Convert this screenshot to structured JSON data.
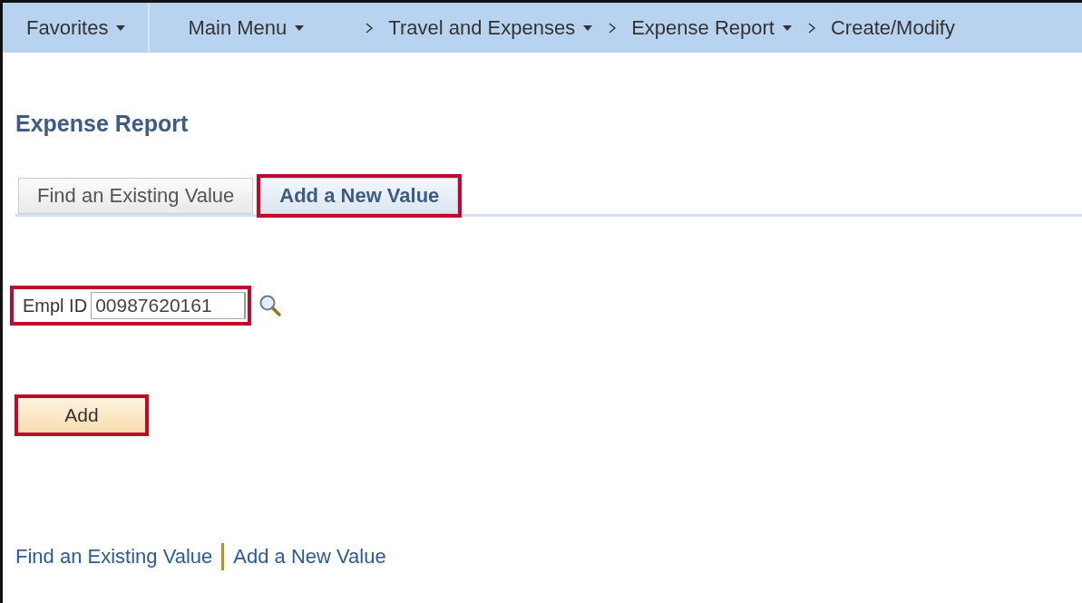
{
  "nav_bar": {
    "items": [
      {
        "kind": "menu",
        "label": "Favorites"
      },
      {
        "kind": "menu",
        "label": "Main Menu"
      },
      {
        "kind": "crumb",
        "label": "Travel and Expenses"
      },
      {
        "kind": "crumb",
        "label": "Expense Report"
      },
      {
        "kind": "crumb-last",
        "label": "Create/Modify"
      }
    ]
  },
  "page_title": "Expense Report",
  "tabs": [
    {
      "label": "Find an Existing Value",
      "selected": false,
      "highlighted": false
    },
    {
      "label": "Add a New Value",
      "selected": true,
      "highlighted": true
    }
  ],
  "empl_id": {
    "label": "Empl ID",
    "value": "00987620161",
    "highlighted": true
  },
  "add_button": {
    "label": "Add",
    "highlighted": true
  },
  "footer_links": [
    "Find an Existing Value",
    "Add a New Value"
  ]
}
